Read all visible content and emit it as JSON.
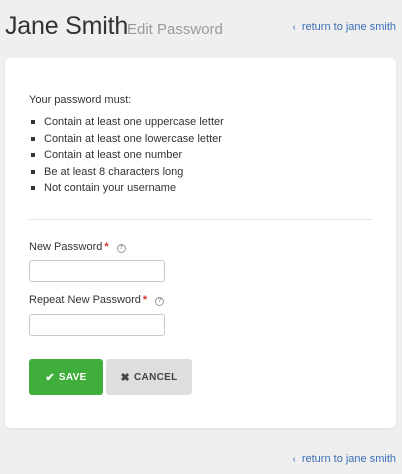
{
  "header": {
    "name": "Jane Smith",
    "subtitle": "Edit Password",
    "return_link": "return to jane smith"
  },
  "rules": {
    "title": "Your password must:",
    "items": [
      "Contain at least one uppercase letter",
      "Contain at least one lowercase letter",
      "Contain at least one number",
      "Be at least 8 characters long",
      "Not contain your username"
    ]
  },
  "form": {
    "new_password_label": "New Password",
    "repeat_password_label": "Repeat New Password",
    "required_mark": "*",
    "help_glyph": "?",
    "new_password_value": "",
    "repeat_password_value": ""
  },
  "buttons": {
    "save_label": "SAVE",
    "cancel_label": "CANCEL"
  },
  "footer": {
    "return_link": "return to jane smith"
  },
  "icons": {
    "chevron": "chevron-left-icon",
    "save": "checkmark-icon",
    "cancel": "x-icon",
    "help": "help-circle-icon"
  },
  "colors": {
    "save_button": "#3fae3a",
    "cancel_button": "#dedede",
    "link": "#3a6fb7",
    "required": "#d9352b"
  }
}
